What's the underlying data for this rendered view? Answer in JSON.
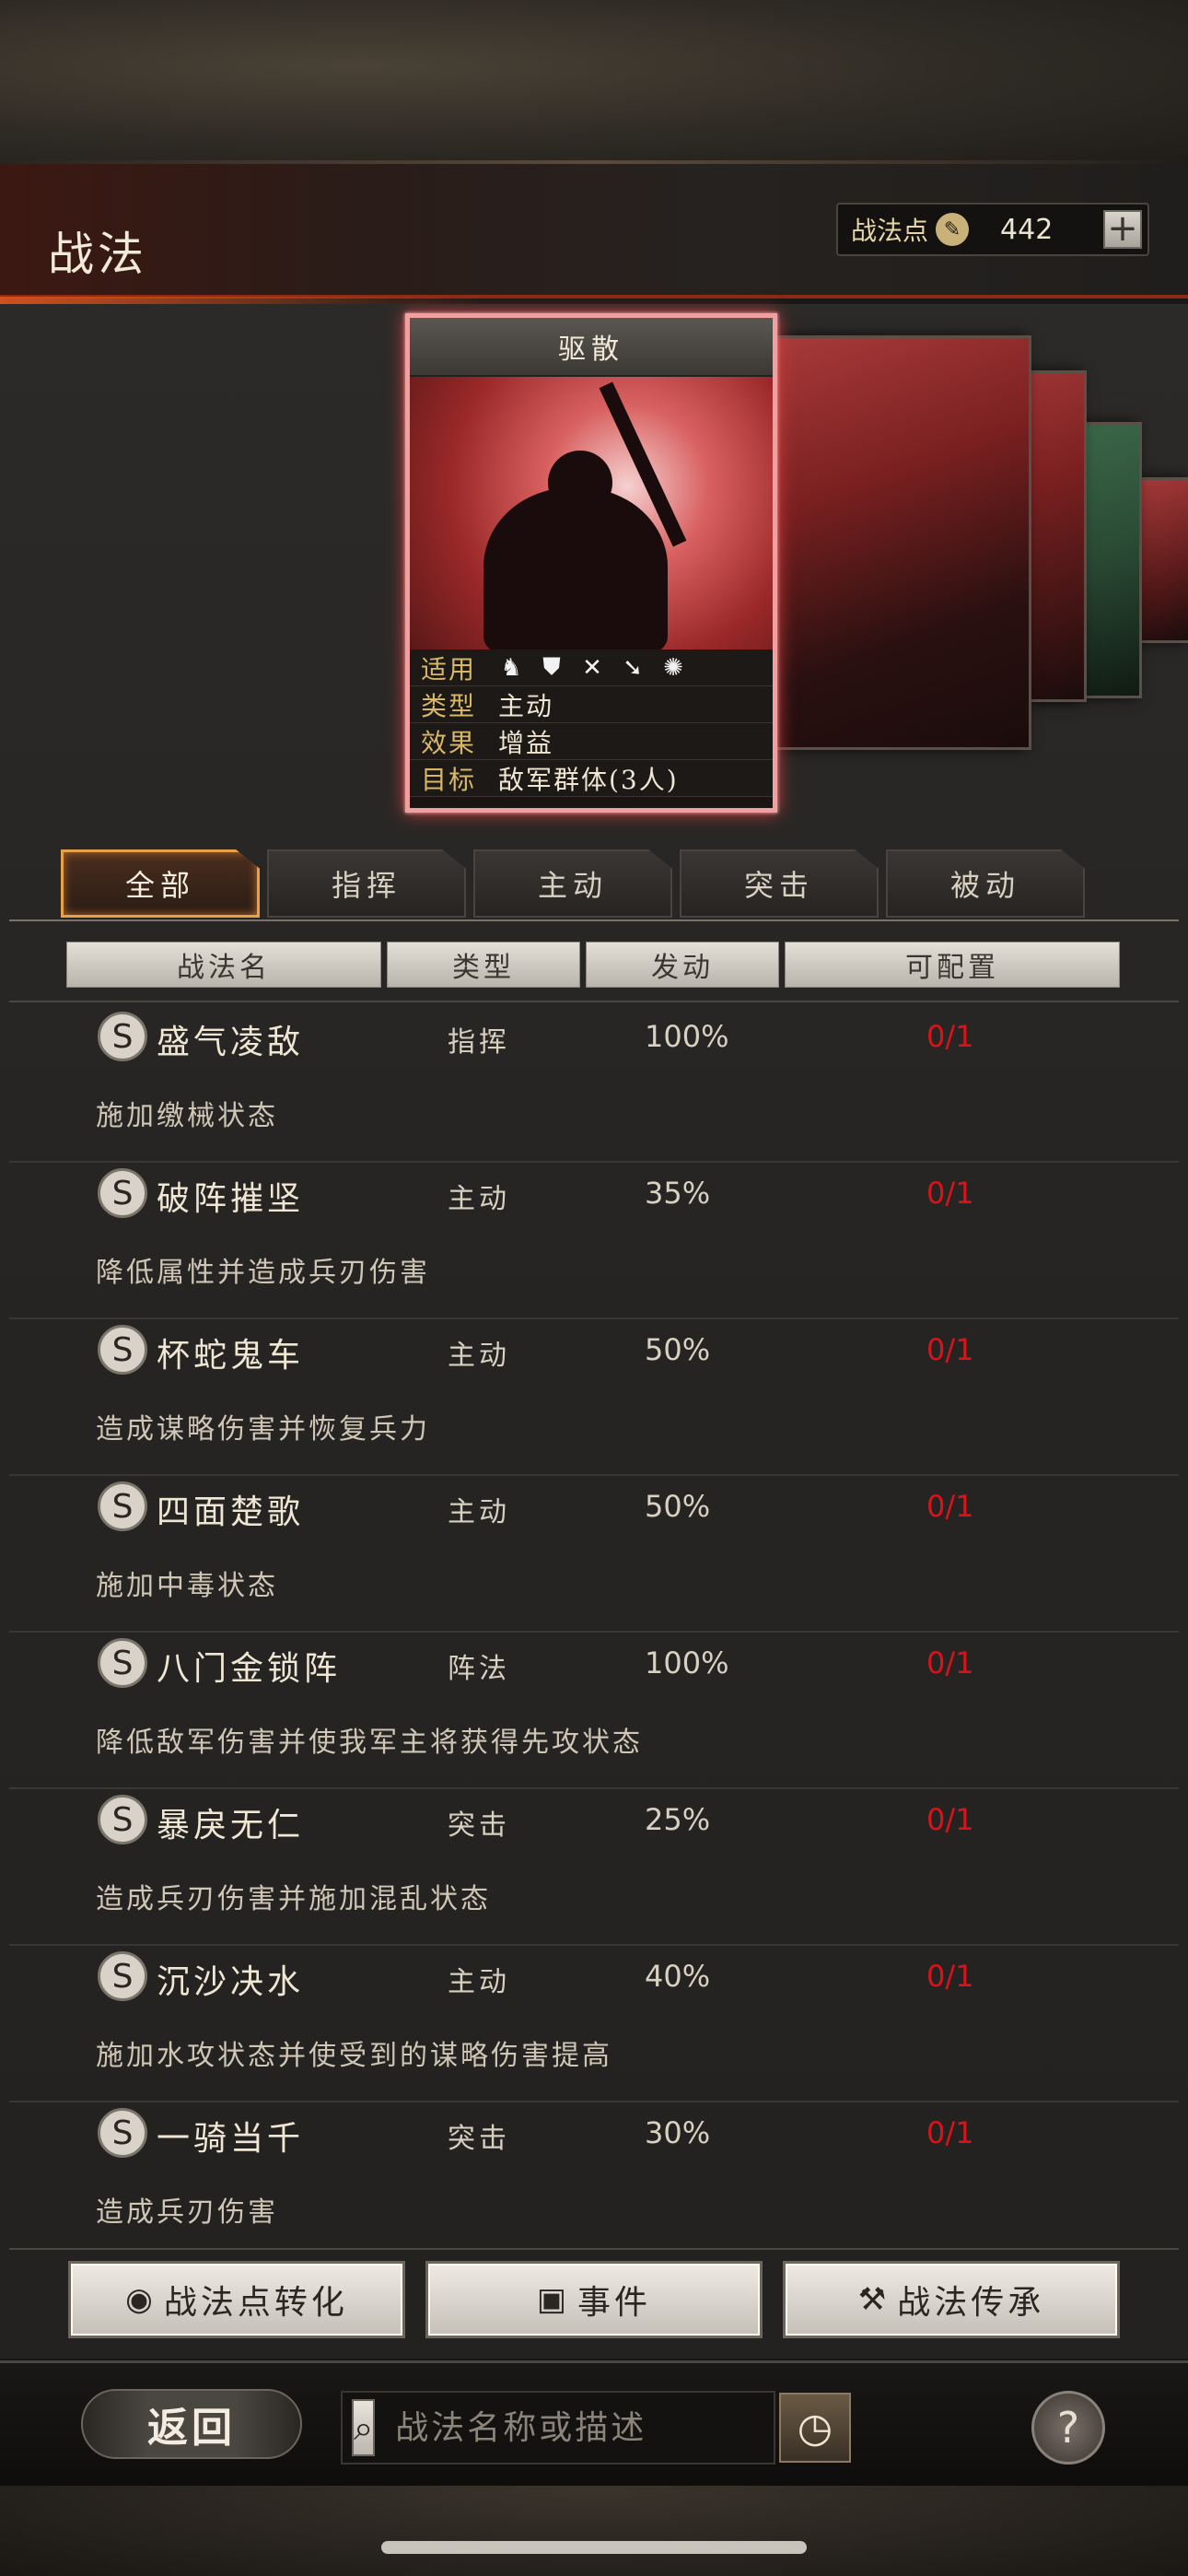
{
  "header": {
    "title": "战法",
    "points_label": "战法点",
    "points_value": "442",
    "plus_label": "+"
  },
  "card": {
    "name": "驱散",
    "rows": [
      {
        "key": "适用",
        "icons": [
          "cavalry-icon",
          "shield-icon",
          "bow-icon",
          "spear-icon",
          "wheel-icon"
        ]
      },
      {
        "key": "类型",
        "value": "主动"
      },
      {
        "key": "效果",
        "value": "增益"
      },
      {
        "key": "目标",
        "value": "敌军群体(3人)"
      }
    ]
  },
  "tabs": [
    {
      "label": "全部",
      "active": true
    },
    {
      "label": "指挥",
      "active": false
    },
    {
      "label": "主动",
      "active": false
    },
    {
      "label": "突击",
      "active": false
    },
    {
      "label": "被动",
      "active": false
    }
  ],
  "columns": {
    "name": "战法名",
    "type": "类型",
    "rate": "发动",
    "slots": "可配置"
  },
  "skills": [
    {
      "badge": "S",
      "name": "盛气凌敌",
      "type": "指挥",
      "rate": "100%",
      "slots": "0/1",
      "desc": "施加缴械状态"
    },
    {
      "badge": "S",
      "name": "破阵摧坚",
      "type": "主动",
      "rate": "35%",
      "slots": "0/1",
      "desc": "降低属性并造成兵刃伤害"
    },
    {
      "badge": "S",
      "name": "杯蛇鬼车",
      "type": "主动",
      "rate": "50%",
      "slots": "0/1",
      "desc": "造成谋略伤害并恢复兵力"
    },
    {
      "badge": "S",
      "name": "四面楚歌",
      "type": "主动",
      "rate": "50%",
      "slots": "0/1",
      "desc": "施加中毒状态"
    },
    {
      "badge": "S",
      "name": "八门金锁阵",
      "type": "阵法",
      "rate": "100%",
      "slots": "0/1",
      "desc": "降低敌军伤害并使我军主将获得先攻状态"
    },
    {
      "badge": "S",
      "name": "暴戾无仁",
      "type": "突击",
      "rate": "25%",
      "slots": "0/1",
      "desc": "造成兵刃伤害并施加混乱状态"
    },
    {
      "badge": "S",
      "name": "沉沙决水",
      "type": "主动",
      "rate": "40%",
      "slots": "0/1",
      "desc": "施加水攻状态并使受到的谋略伤害提高"
    },
    {
      "badge": "S",
      "name": "一骑当千",
      "type": "突击",
      "rate": "30%",
      "slots": "0/1",
      "desc": "造成兵刃伤害"
    }
  ],
  "actions": {
    "convert": "战法点转化",
    "event": "事件",
    "inherit": "战法传承"
  },
  "footer": {
    "back": "返回",
    "search_placeholder": "战法名称或描述",
    "help": "?"
  },
  "colors": {
    "accent": "#e6a24a",
    "slots_red": "#d8141a",
    "card_glow": "#d84040"
  }
}
